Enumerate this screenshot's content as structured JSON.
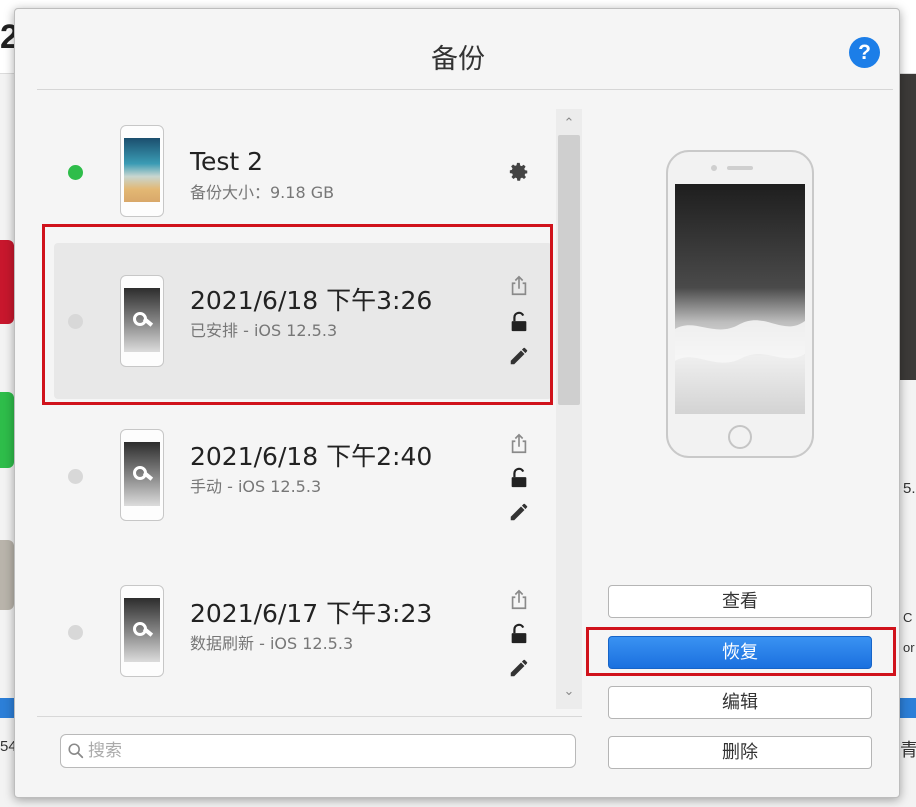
{
  "background": {
    "left_number": "2",
    "left_text": "54",
    "right_text_1": "5.",
    "right_text_2": "C",
    "right_text_3": "or",
    "right_text_4": "青"
  },
  "dialog": {
    "title": "备份",
    "help_label": "?"
  },
  "backups": [
    {
      "title": "Test 2",
      "subtitle": "备份大小：9.18 GB",
      "status": "active"
    },
    {
      "title": "2021/6/18 下午3:26",
      "subtitle": "已安排 - iOS 12.5.3",
      "status": "inactive",
      "selected": true
    },
    {
      "title": "2021/6/18 下午2:40",
      "subtitle": "手动 - iOS 12.5.3",
      "status": "inactive"
    },
    {
      "title": "2021/6/17 下午3:23",
      "subtitle": "数据刷新 - iOS 12.5.3",
      "status": "inactive"
    }
  ],
  "search": {
    "placeholder": "搜索",
    "value": ""
  },
  "actions": {
    "view_label": "查看",
    "restore_label": "恢复",
    "edit_label": "编辑",
    "delete_label": "删除"
  },
  "scroll": {
    "up_glyph": "⌃",
    "down_glyph": "⌄"
  },
  "colors": {
    "accent": "#1a70df",
    "active_dot": "#2ebd4a",
    "annotation": "#d0121b"
  },
  "icons": [
    "gear-icon",
    "share-icon",
    "lock-icon",
    "pencil-icon",
    "search-icon",
    "help-icon"
  ]
}
